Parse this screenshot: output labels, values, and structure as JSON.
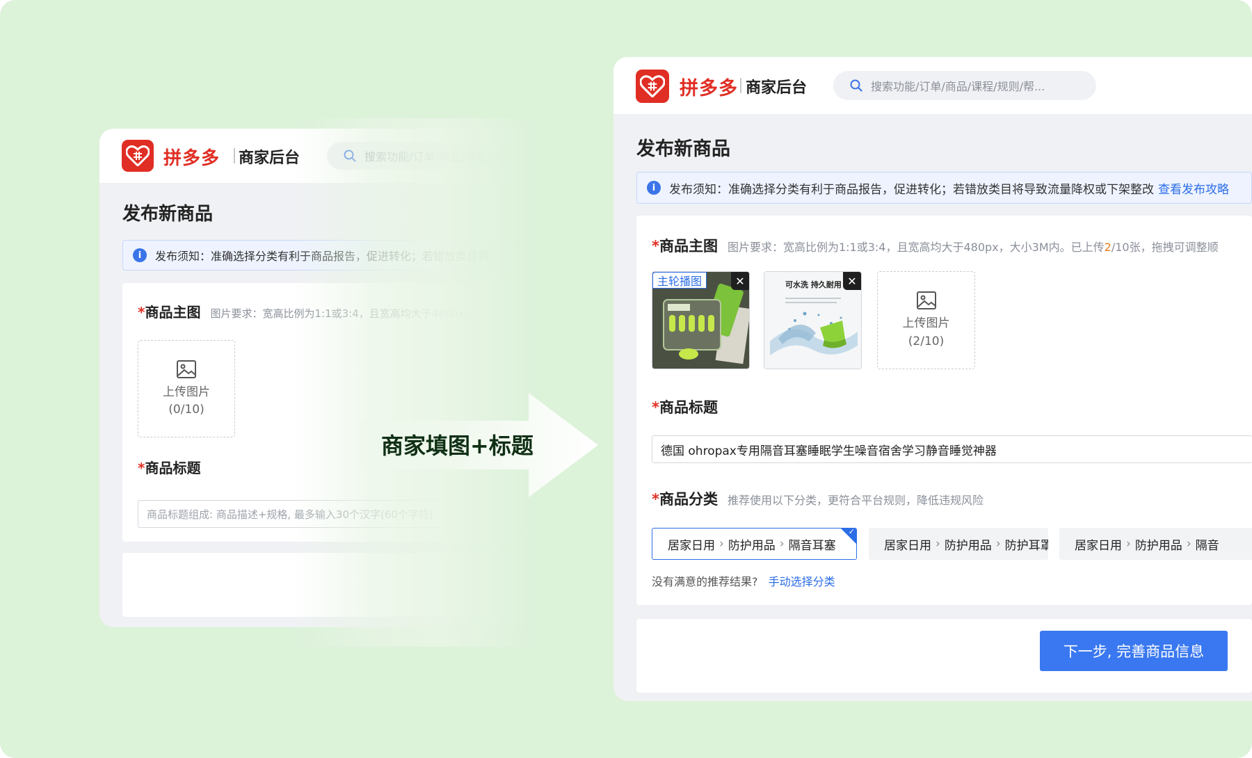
{
  "arrow_label": "商家填图+标题",
  "left": {
    "brand": "拼多多",
    "brand_sub": "商家后台",
    "search_placeholder": "搜索功能/订单/商品/课程/规则",
    "page_title": "发布新商品",
    "notice": "发布须知：准确选择分类有利于商品报告，促进转化；若错放类目将",
    "main_image": {
      "required_mark": "*",
      "label": "商品主图",
      "hint": "图片要求：宽高比例为1:1或3:4，且宽高均大于480px，"
    },
    "upload": {
      "label": "上传图片",
      "count": "(0/10)"
    },
    "title_field": {
      "required_mark": "*",
      "label": "商品标题",
      "placeholder": "商品标题组成: 商品描述+规格, 最多输入30个汉字(60个字符)"
    }
  },
  "right": {
    "brand": "拼多多",
    "brand_sub": "商家后台",
    "search_placeholder": "搜索功能/订单/商品/课程/规则/帮...",
    "page_title": "发布新商品",
    "notice": "发布须知：准确选择分类有利于商品报告，促进转化；若错放类目将导致流量降权或下架整改",
    "notice_link": "查看发布攻略",
    "main_image": {
      "required_mark": "*",
      "label": "商品主图",
      "hint_before": "图片要求：宽高比例为1:1或3:4，且宽高均大于480px，大小3M内。已上传",
      "uploaded_count": "2",
      "hint_after": "/10张，拖拽可调整顺"
    },
    "thumbs": [
      {
        "tag": "主轮播图",
        "close": "✕",
        "caption": ""
      },
      {
        "tag": "",
        "close": "✕",
        "caption": "可水洗 持久耐用"
      }
    ],
    "upload": {
      "label": "上传图片",
      "count": "(2/10)"
    },
    "title_field": {
      "required_mark": "*",
      "label": "商品标题",
      "value": "德国 ohropax专用隔音耳塞睡眠学生噪音宿舍学习静音睡觉神器"
    },
    "category": {
      "required_mark": "*",
      "label": "商品分类",
      "hint": "推荐使用以下分类，更符合平台规则，降低违规风险",
      "options": [
        {
          "l1": "居家日用",
          "l2": "防护用品",
          "l3": "隔音耳塞",
          "selected": true
        },
        {
          "l1": "居家日用",
          "l2": "防护用品",
          "l3": "防护耳罩",
          "selected": false
        },
        {
          "l1": "居家日用",
          "l2": "防护用品",
          "l3": "隔音",
          "selected": false
        }
      ],
      "not_satisfied": "没有满意的推荐结果?",
      "manual_link": "手动选择分类"
    },
    "next_button": "下一步, 完善商品信息"
  },
  "colors": {
    "background": "#dcf2d9",
    "brand_red": "#e02e24",
    "primary_blue": "#3978f0",
    "link_blue": "#2b6de6"
  }
}
